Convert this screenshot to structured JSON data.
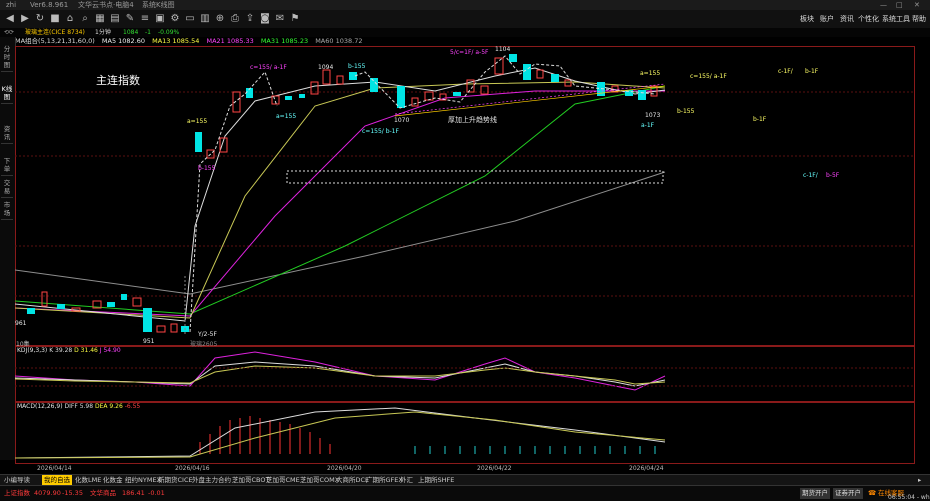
{
  "window": {
    "app": "zhi",
    "ver": "Ver6.8.961",
    "docs": "文华云书点·电脑4",
    "sys": "系统K线图",
    "controls": [
      "—",
      "□",
      "✕"
    ]
  },
  "menu": [
    "板块",
    "账户",
    "资讯",
    "个性化",
    "系统工具",
    "帮助"
  ],
  "toolbar_icons": [
    "back-icon",
    "forward-icon",
    "refresh-icon",
    "stop-icon",
    "home-icon",
    "search-icon",
    "grid-icon",
    "chart-icon",
    "draw-icon",
    "list-icon",
    "calc-icon",
    "settings-icon",
    "window-icon",
    "layout-icon",
    "zoom-icon",
    "print-icon",
    "export-icon",
    "lock-icon",
    "note-icon",
    "alert-icon"
  ],
  "info": {
    "symbol": "玻璃主连(CICE 8734)",
    "period": "1分钟",
    "price": "1084",
    "change": "-1",
    "pct": "-0.09%"
  },
  "ma": {
    "label": "MA组合(5,13,21,31,60,0)",
    "ma5": "MA5 1082.60",
    "ma13": "MA13 1085.54",
    "ma21": "MA21 1085.33",
    "ma31": "MA31 1085.23",
    "ma60": "MA60 1038.72"
  },
  "left_tabs": [
    "分时图",
    "K线图",
    "资讯",
    "下单",
    "交易",
    "市场"
  ],
  "chart": {
    "title": "主连指数",
    "trend_label": "厚加上升趋势线",
    "price_labels": {
      "p1104": "1104",
      "p1094": "1094",
      "p1070": "1070",
      "p1073": "1073",
      "p961": "961",
      "p951": "951"
    },
    "annot": {
      "a155_left": "a=155",
      "b155_left": "b-155",
      "c155_top": "c=155/ a-1F",
      "a155_mid": "a=155",
      "b155_mid": "b-155",
      "c155_mid": "c=155/  b-1F",
      "cap_top": "5/c=1F/ a-5F",
      "a155_right": "a=155",
      "b155_right": "b-155",
      "a1f_right": "a-1F",
      "right1": "c=155/  a-1F",
      "right2": "c-1F/",
      "right3": "b-1F",
      "right4": "b-1F",
      "right5": "c-1F/",
      "right6": "b-5F",
      "y25": "Y/2-5F",
      "bottom_note": "10集",
      "vol_note": "玻璃2605"
    }
  },
  "kdj": {
    "label": "KDJ(9,3,3)",
    "k": "K 39.28",
    "d": "D 31.46",
    "j": "J 54.90"
  },
  "macd": {
    "label": "MACD(12,26,9)",
    "diff": "DIFF 5.98",
    "dea": "DEA 9.26",
    "macd": "-6.55"
  },
  "dates": [
    "2026/04/14",
    "2026/04/16",
    "2026/04/20",
    "2026/04/22",
    "2026/04/24"
  ],
  "bottom_tabs": [
    "小编导读",
    "我的自选",
    "化数LME",
    "化数金",
    "纽约NYMEX",
    "新期货CICE",
    "外盘主力合约",
    "芝加哥CBOT",
    "芝加哥CME",
    "芝加哥COMX",
    "大商所DCE",
    "广期所GFEX",
    "外汇",
    "上期所SHFE"
  ],
  "status": {
    "sh_label": "上证指数",
    "sh_val": "4079.90",
    "sh_chg": "-15.35",
    "wh_label": "文华商品",
    "wh_val": "186.41",
    "wh_chg": "-0.01",
    "buy": "期货开户",
    "sell": "证券开户",
    "online": "在线客服",
    "time": "06:55:04 - wh"
  }
}
